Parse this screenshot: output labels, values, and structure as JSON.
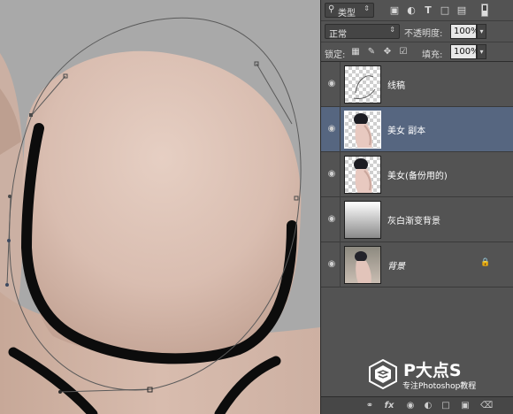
{
  "toolbar": {
    "kind_select": "类型",
    "blend_mode": "正常",
    "opacity_label": "不透明度:",
    "opacity_value": "100%",
    "lock_label": "锁定:",
    "fill_label": "填充:",
    "fill_value": "100%"
  },
  "layers": [
    {
      "name": "线稿",
      "thumb": "transparent-lines",
      "selected": false,
      "italic": false,
      "locked": false
    },
    {
      "name": "美女 副本",
      "thumb": "transparent-woman",
      "selected": true,
      "italic": false,
      "locked": false
    },
    {
      "name": "美女(备份用的)",
      "thumb": "transparent-woman",
      "selected": false,
      "italic": false,
      "locked": false
    },
    {
      "name": "灰白渐变背景",
      "thumb": "gradient",
      "selected": false,
      "italic": false,
      "locked": false
    },
    {
      "name": "背景",
      "thumb": "photo",
      "selected": false,
      "italic": true,
      "locked": true
    }
  ],
  "watermark": {
    "brand": "P大点S",
    "subtitle": "专注Photoshop教程"
  },
  "colors": {
    "panel_bg": "#535353",
    "selected_layer": "#566680",
    "canvas_bg": "#a7a7a7",
    "skin": "#d9bdb1"
  }
}
